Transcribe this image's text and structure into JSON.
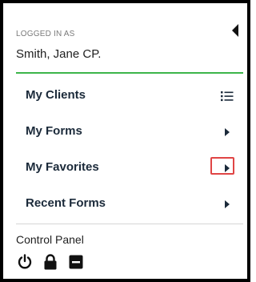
{
  "header": {
    "logged_in_label": "LOGGED IN AS",
    "user_name": "Smith, Jane CP."
  },
  "menu": {
    "items": [
      {
        "label": "My Clients",
        "icon": "list-icon"
      },
      {
        "label": "My Forms",
        "icon": "chevron-right-icon"
      },
      {
        "label": "My Favorites",
        "icon": "chevron-right-icon",
        "highlighted": true
      },
      {
        "label": "Recent Forms",
        "icon": "chevron-right-icon"
      }
    ]
  },
  "control_panel": {
    "title": "Control Panel",
    "icons": [
      "power-icon",
      "lock-icon",
      "minus-square-icon"
    ]
  },
  "colors": {
    "accent_green": "#3cb54a",
    "highlight_red": "#e04545",
    "text_dark": "#1b2a3a"
  }
}
